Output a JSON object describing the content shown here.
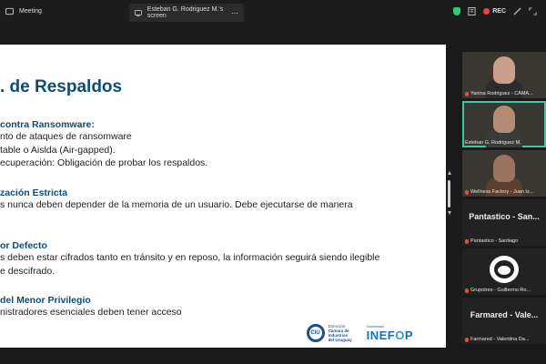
{
  "topbar": {
    "meeting_tab": "Meeting",
    "share_tab": "Esteban G. Rodriguez M.'s screen",
    "more": "⋯",
    "rec_label": "REC"
  },
  "slide": {
    "title": ". de Respaldos",
    "sections": [
      {
        "head": "contra Ransomware:",
        "lines": [
          "nto de ataques de ransomware",
          "table o Aislda (Air-gapped).",
          "ecuperación: Obligación de probar los respaldos."
        ]
      },
      {
        "head": "zación Estricta",
        "lines": [
          "s nunca deben depender de la memoria de un usuario. Debe ejecutarse de manera"
        ]
      },
      {
        "head": "or Defecto",
        "lines": [
          "s deben estar cifrados tanto en tránsito y en reposo, la información seguirá siendo ilegible",
          "e descifrado."
        ]
      },
      {
        "head": "del Menor Privilegio",
        "lines": [
          "nistradores esenciales deben tener acceso"
        ]
      }
    ],
    "logos": {
      "ciu_small": "Dirección",
      "ciu_line1": "Cámara de",
      "ciu_line2": "Industrias",
      "ciu_line3": "del Uruguay",
      "ciu_mark": "CIU",
      "inefop_small": "Conformado",
      "inefop_a": "INEF",
      "inefop_b": "O",
      "inefop_c": "P"
    }
  },
  "participants": [
    {
      "caption": "Yanina Rodriguez - CÁMA...",
      "type": "video",
      "skin": "#caa08c",
      "shirt": "#2c2c2c"
    },
    {
      "caption": "Esteban G. Rodriguez M.",
      "type": "video",
      "skin": "#b48b74",
      "shirt": "#3b3b3b",
      "active": true
    },
    {
      "caption": "Wellness Factory - Juan Iz...",
      "type": "video",
      "skin": "#9a7460",
      "shirt": "#5a3f30"
    },
    {
      "bigname": "Pantastico - San...",
      "caption": "Pantastico - Santiago",
      "type": "name"
    },
    {
      "caption": "Grupotres - Guillermo Ro...",
      "type": "avatar"
    },
    {
      "bigname": "Farmared - Vale...",
      "caption": "Farmared - Valentina Da...",
      "type": "name"
    }
  ]
}
